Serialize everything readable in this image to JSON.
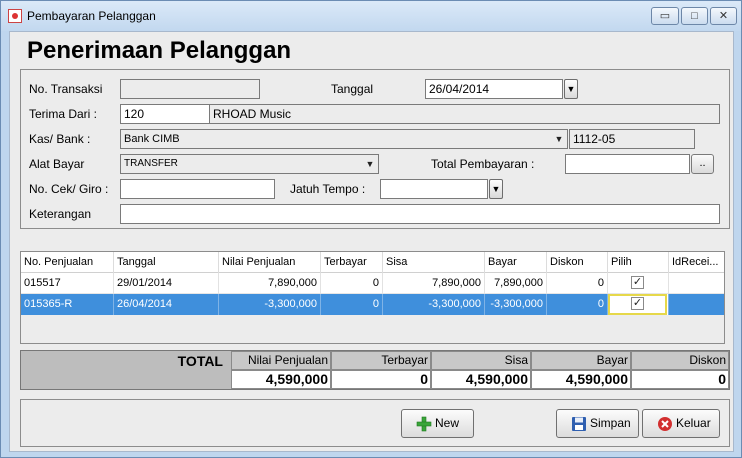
{
  "window": {
    "title": "Pembayaran Pelanggan",
    "controls": {
      "minimize": "▭",
      "maximize": "□",
      "close": "✕"
    }
  },
  "heading": "Penerimaan Pelanggan",
  "form": {
    "no_transaksi_label": "No. Transaksi",
    "no_transaksi_value": "",
    "tanggal_label": "Tanggal",
    "tanggal_value": "26/04/2014",
    "terima_dari_label": "Terima Dari :",
    "terima_dari_code": "120",
    "terima_dari_name": "RHOAD Music",
    "kas_bank_label": "Kas/ Bank :",
    "kas_bank_value": "Bank CIMB",
    "kas_bank_account": "1112-05",
    "alat_bayar_label": "Alat Bayar",
    "alat_bayar_value": "TRANSFER",
    "total_pembayaran_label": "Total Pembayaran :",
    "total_pembayaran_value": "",
    "browse_label": "..",
    "no_cek_label": "No. Cek/ Giro :",
    "no_cek_value": "",
    "jatuh_tempo_label": "Jatuh Tempo :",
    "jatuh_tempo_value": "",
    "keterangan_label": "Keterangan",
    "keterangan_value": ""
  },
  "table": {
    "columns": [
      "No. Penjualan",
      "Tanggal",
      "Nilai Penjualan",
      "Terbayar",
      "Sisa",
      "Bayar",
      "Diskon",
      "Pilih",
      "IdRecei..."
    ],
    "rows": [
      {
        "no": "015517",
        "tanggal": "29/01/2014",
        "nilai": "7,890,000",
        "terbayar": "0",
        "sisa": "7,890,000",
        "bayar": "7,890,000",
        "diskon": "0",
        "pilih": true,
        "selected": false
      },
      {
        "no": "015365-R",
        "tanggal": "26/04/2014",
        "nilai": "-3,300,000",
        "terbayar": "0",
        "sisa": "-3,300,000",
        "bayar": "-3,300,000",
        "diskon": "0",
        "pilih": true,
        "selected": true
      }
    ]
  },
  "totals": {
    "label": "TOTAL",
    "headers": [
      "Nilai Penjualan",
      "Terbayar",
      "Sisa",
      "Bayar",
      "Diskon"
    ],
    "values": [
      "4,590,000",
      "0",
      "4,590,000",
      "4,590,000",
      "0"
    ]
  },
  "buttons": {
    "new": "New",
    "simpan": "Simpan",
    "keluar": "Keluar"
  },
  "colors": {
    "selection": "#3f8fdc",
    "focus_border": "#e6d84a",
    "new_icon": "#3aa53a",
    "save_icon": "#2f5fb0",
    "exit_icon": "#d22f2f"
  }
}
